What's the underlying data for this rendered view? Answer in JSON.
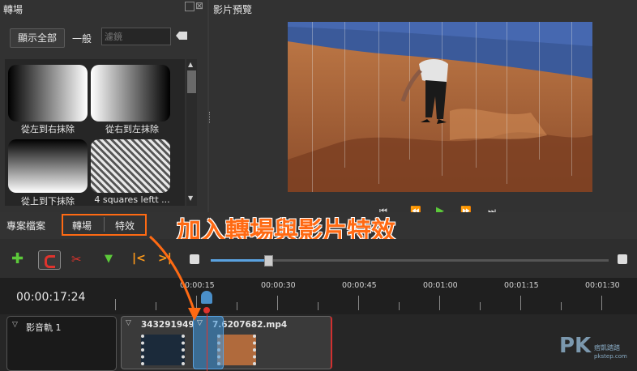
{
  "transitions_panel": {
    "title": "轉場",
    "show_all_button": "顯示全部",
    "general_label": "一般",
    "filter_placeholder": "濾鏡",
    "items": [
      {
        "label": "從左到右抹除"
      },
      {
        "label": "從右到左抹除"
      },
      {
        "label": "從上到下抹除"
      },
      {
        "label": "4 squares leftt ..."
      }
    ]
  },
  "preview_panel": {
    "title": "影片預覽"
  },
  "tabs": {
    "project_files": "專案檔案",
    "transitions": "轉場",
    "effects": "特效"
  },
  "annotation": {
    "text": "加入轉場與影片特效",
    "color": "#ff6a13"
  },
  "timeline": {
    "current_time": "00:00:17:24",
    "ruler_labels": [
      "00:00:15",
      "00:00:30",
      "00:00:45",
      "00:01:00",
      "00:01:15",
      "00:01:30"
    ],
    "track_name": "影音軌 1",
    "clips": [
      {
        "name": "343291949"
      },
      {
        "name": "7.6207682.mp4"
      }
    ]
  },
  "watermark": {
    "brand": "PK",
    "sub": "痞凱踏踏",
    "domain": "pkstep.com"
  },
  "colors": {
    "accent": "#ff6a13",
    "playhead": "#4a8fc9",
    "add_icon": "#5cc93a",
    "magnet": "#e0332d"
  }
}
